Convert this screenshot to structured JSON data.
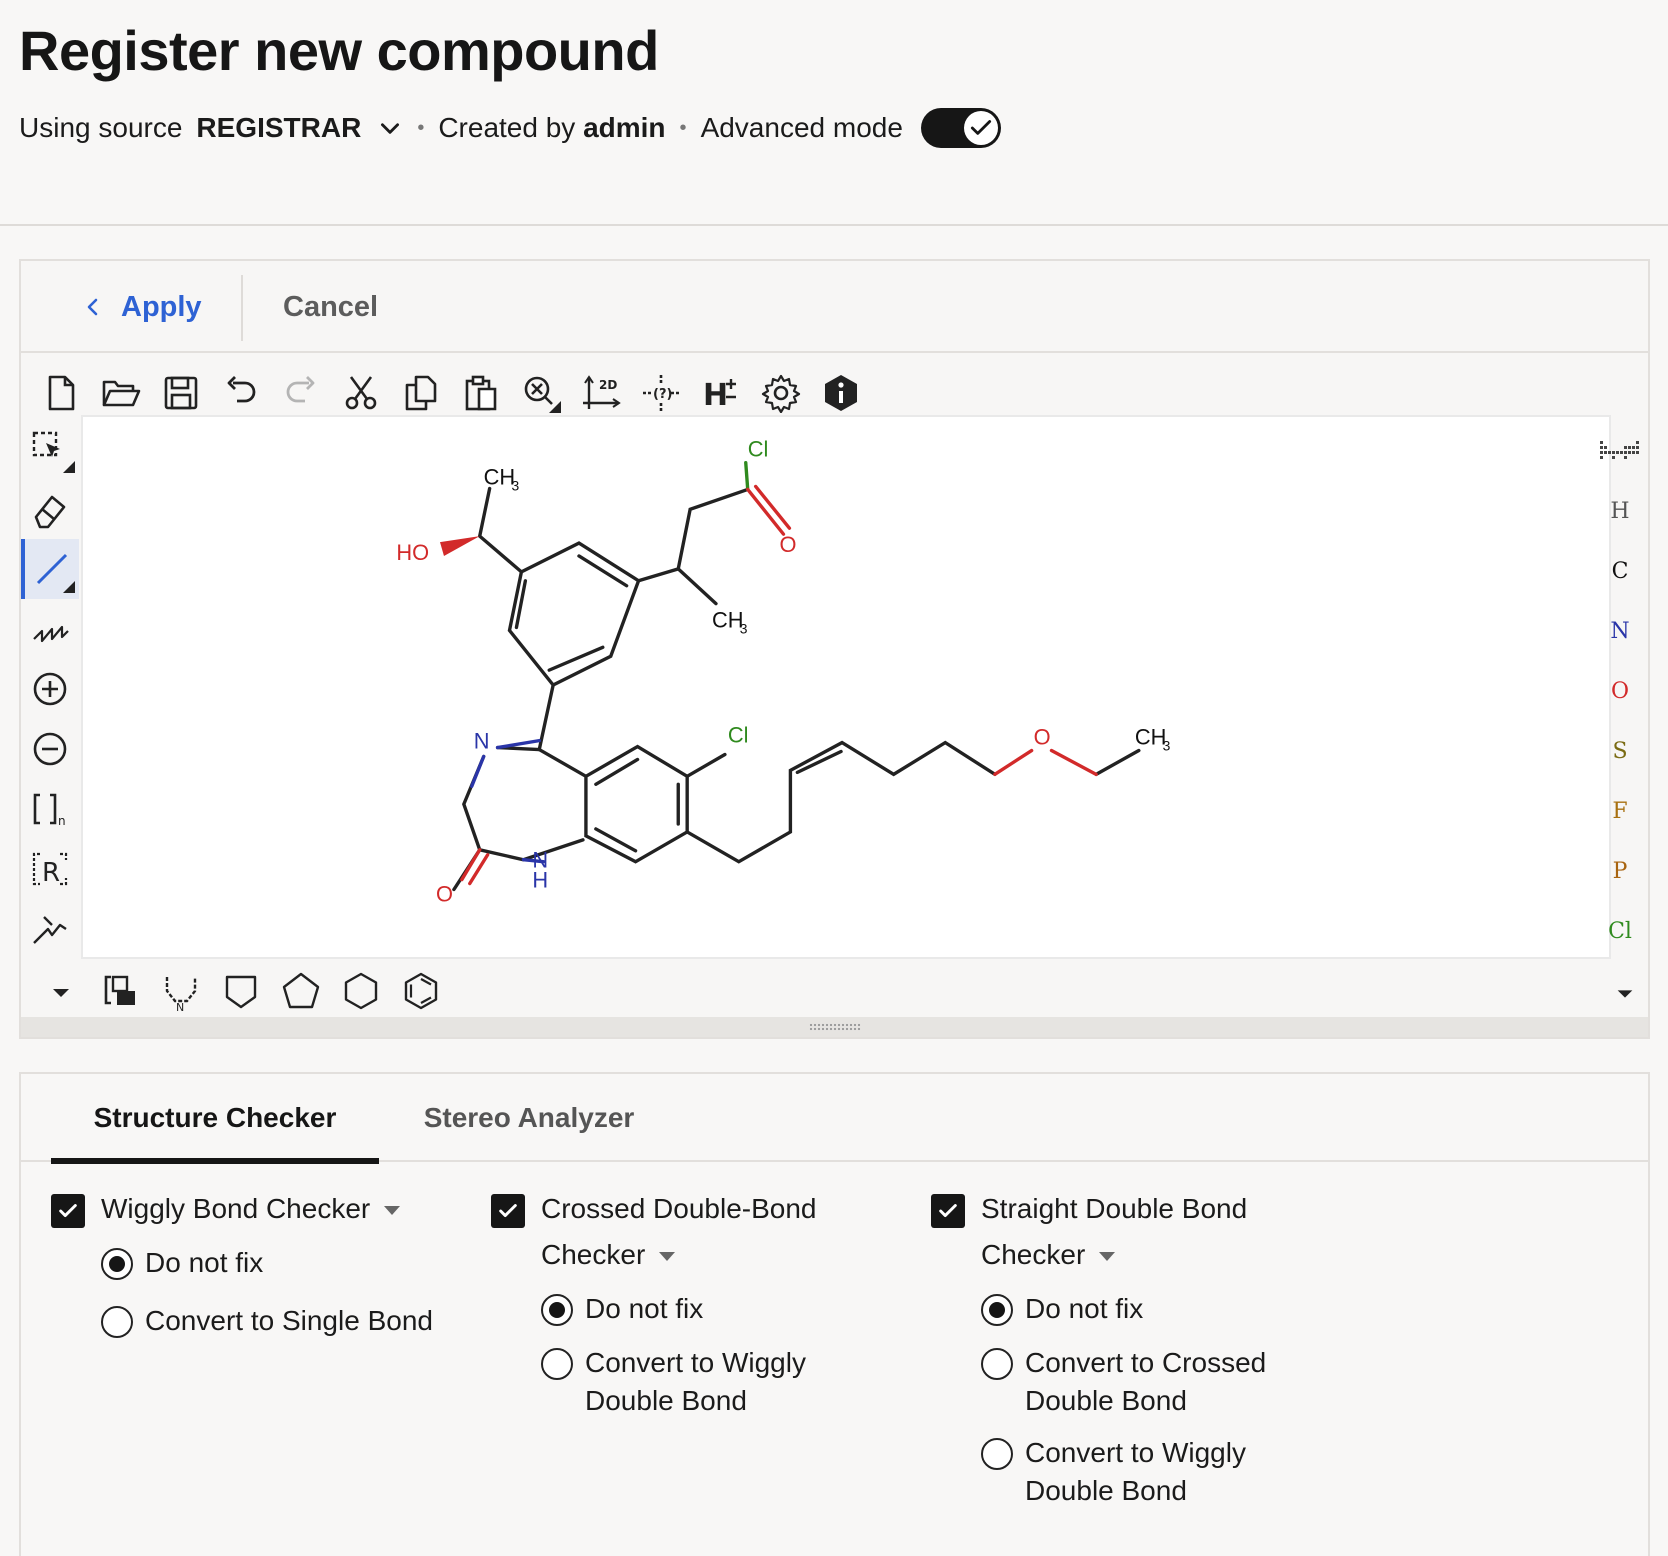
{
  "header": {
    "title": "Register new compound",
    "source_prefix": "Using source",
    "source_value": "REGISTRAR",
    "created_prefix": "Created by",
    "created_user": "admin",
    "advanced_label": "Advanced mode",
    "advanced_on": true
  },
  "editor": {
    "apply_label": "Apply",
    "cancel_label": "Cancel",
    "elements": [
      {
        "symbol": "H",
        "color": "#555555"
      },
      {
        "symbol": "C",
        "color": "#111111"
      },
      {
        "symbol": "N",
        "color": "#2a35a8"
      },
      {
        "symbol": "O",
        "color": "#d22a2a"
      },
      {
        "symbol": "S",
        "color": "#7a6b12"
      },
      {
        "symbol": "F",
        "color": "#a87010"
      },
      {
        "symbol": "P",
        "color": "#a86410"
      },
      {
        "symbol": "Cl",
        "color": "#2f8a1e"
      }
    ],
    "molecule_labels": {
      "ch3_top": "CH",
      "ch3_mid": "CH",
      "ch3_right": "CH",
      "sub3": "3",
      "cl_top": "Cl",
      "cl_ring": "Cl",
      "ho": "HO",
      "o_acyl": "O",
      "n_ring": "N",
      "nh_n": "N",
      "nh_h": "H",
      "o_lactam": "O",
      "o_ether": "O"
    },
    "top_tools": [
      "new-document-icon",
      "open-folder-icon",
      "save-icon",
      "undo-icon",
      "redo-icon",
      "cut-icon",
      "copy-icon",
      "paste-icon",
      "clean-zoom-icon",
      "clean-2d-icon",
      "query-icon",
      "hydrogen-icon",
      "settings-icon",
      "info-icon"
    ],
    "left_tools": [
      "select-icon",
      "eraser-icon",
      "single-bond-icon",
      "chain-icon",
      "charge-plus-icon",
      "charge-minus-icon",
      "sgroup-icon",
      "rgroup-icon",
      "reaction-arrow-icon"
    ],
    "bottom_tools": [
      "template-icon",
      "n-ring-icon",
      "cyclobutane-icon",
      "cyclopentane-icon",
      "cyclohexane-icon",
      "benzene-icon"
    ]
  },
  "checker": {
    "tabs": [
      {
        "label": "Structure Checker",
        "active": true
      },
      {
        "label": "Stereo Analyzer",
        "active": false
      }
    ],
    "columns": [
      {
        "title": "Wiggly Bond Checker",
        "checked": true,
        "options": [
          {
            "label": "Do not fix",
            "selected": true
          },
          {
            "label": "Convert to Single Bond",
            "selected": false
          }
        ]
      },
      {
        "title": "Crossed Double-Bond Checker",
        "checked": true,
        "options": [
          {
            "label": "Do not fix",
            "selected": true
          },
          {
            "label": "Convert to Wiggly Double Bond",
            "selected": false
          }
        ]
      },
      {
        "title": "Straight Double Bond Checker",
        "checked": true,
        "options": [
          {
            "label": "Do not fix",
            "selected": true
          },
          {
            "label": "Convert to Crossed Double Bond",
            "selected": false
          },
          {
            "label": "Convert to Wiggly Double Bond",
            "selected": false
          }
        ]
      }
    ]
  }
}
